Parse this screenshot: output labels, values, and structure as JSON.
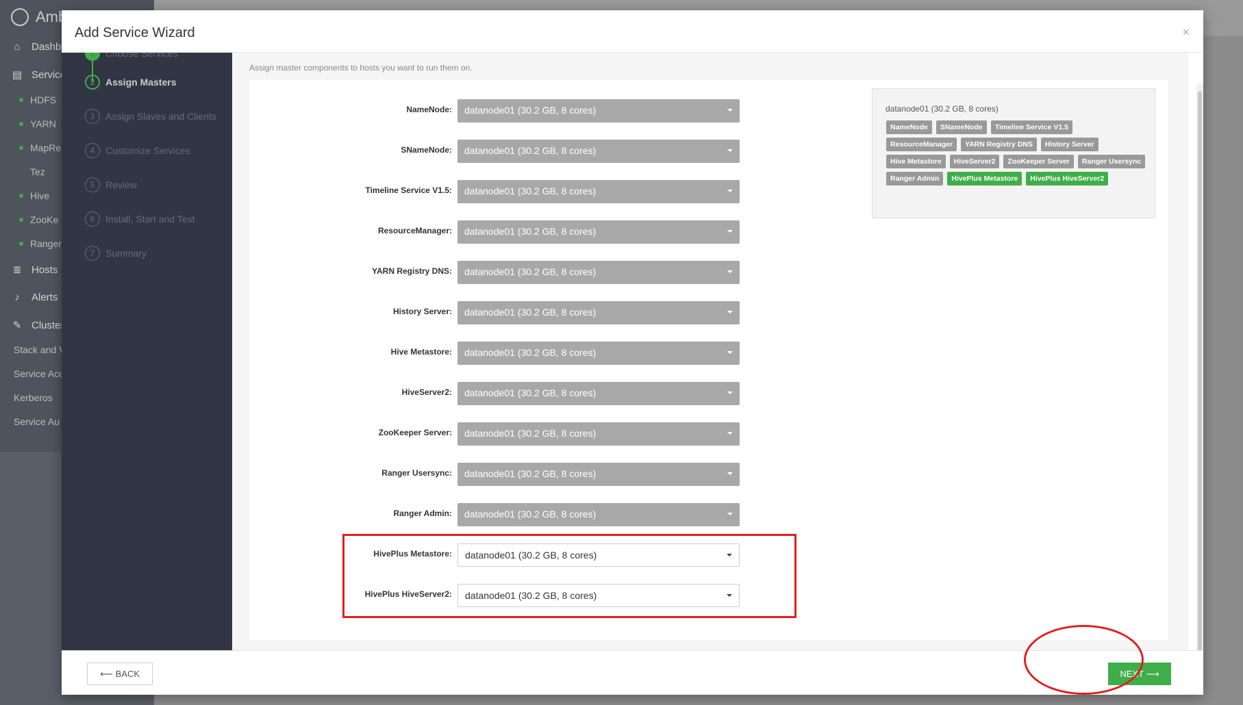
{
  "background": {
    "logo": "Amb",
    "nav": [
      {
        "label": "Dashbo",
        "icon": "home-icon"
      },
      {
        "label": "Service",
        "icon": "briefcase-icon"
      }
    ],
    "services": [
      {
        "label": "HDFS",
        "status": true
      },
      {
        "label": "YARN",
        "status": true
      },
      {
        "label": "MapRe",
        "status": true
      },
      {
        "label": "Tez",
        "status": false
      },
      {
        "label": "Hive",
        "status": true
      },
      {
        "label": "ZooKe",
        "status": true
      },
      {
        "label": "Ranger",
        "status": true
      }
    ],
    "nav2": [
      {
        "label": "Hosts",
        "icon": "server-icon"
      },
      {
        "label": "Alerts",
        "icon": "bell-icon"
      },
      {
        "label": "Cluster",
        "icon": "wrench-icon"
      }
    ],
    "cluster_items": [
      "Stack and V",
      "Service Acc",
      "Kerberos",
      "Service Au"
    ]
  },
  "modal": {
    "title": "Add Service Wizard",
    "close": "×"
  },
  "steps": [
    {
      "num": "1",
      "label": "Choose Services",
      "state": "done"
    },
    {
      "num": "2",
      "label": "Assign Masters",
      "state": "current"
    },
    {
      "num": "3",
      "label": "Assign Slaves and Clients",
      "state": "pending"
    },
    {
      "num": "4",
      "label": "Customize Services",
      "state": "pending"
    },
    {
      "num": "5",
      "label": "Review",
      "state": "pending"
    },
    {
      "num": "6",
      "label": "Install, Start and Test",
      "state": "pending"
    },
    {
      "num": "7",
      "label": "Summary",
      "state": "pending"
    }
  ],
  "intro": "Assign master components to hosts you want to run them on.",
  "assignments": [
    {
      "label": "NameNode:",
      "value": "datanode01 (30.2 GB, 8 cores)",
      "active": false
    },
    {
      "label": "SNameNode:",
      "value": "datanode01 (30.2 GB, 8 cores)",
      "active": false
    },
    {
      "label": "Timeline Service V1.5:",
      "value": "datanode01 (30.2 GB, 8 cores)",
      "active": false
    },
    {
      "label": "ResourceManager:",
      "value": "datanode01 (30.2 GB, 8 cores)",
      "active": false
    },
    {
      "label": "YARN Registry DNS:",
      "value": "datanode01 (30.2 GB, 8 cores)",
      "active": false
    },
    {
      "label": "History Server:",
      "value": "datanode01 (30.2 GB, 8 cores)",
      "active": false
    },
    {
      "label": "Hive Metastore:",
      "value": "datanode01 (30.2 GB, 8 cores)",
      "active": false
    },
    {
      "label": "HiveServer2:",
      "value": "datanode01 (30.2 GB, 8 cores)",
      "active": false
    },
    {
      "label": "ZooKeeper Server:",
      "value": "datanode01 (30.2 GB, 8 cores)",
      "active": false
    },
    {
      "label": "Ranger Usersync:",
      "value": "datanode01 (30.2 GB, 8 cores)",
      "active": false
    },
    {
      "label": "Ranger Admin:",
      "value": "datanode01 (30.2 GB, 8 cores)",
      "active": false
    },
    {
      "label": "HivePlus Metastore:",
      "value": "datanode01 (30.2 GB, 8 cores)",
      "active": true
    },
    {
      "label": "HivePlus HiveServer2:",
      "value": "datanode01 (30.2 GB, 8 cores)",
      "active": true
    }
  ],
  "host_summary": {
    "title": "datanode01 (30.2 GB, 8 cores)",
    "tags": [
      {
        "label": "NameNode",
        "new": false
      },
      {
        "label": "SNameNode",
        "new": false
      },
      {
        "label": "Timeline Service V1.5",
        "new": false
      },
      {
        "label": "ResourceManager",
        "new": false
      },
      {
        "label": "YARN Registry DNS",
        "new": false
      },
      {
        "label": "History Server",
        "new": false
      },
      {
        "label": "Hive Metastore",
        "new": false
      },
      {
        "label": "HiveServer2",
        "new": false
      },
      {
        "label": "ZooKeeper Server",
        "new": false
      },
      {
        "label": "Ranger Usersync",
        "new": false
      },
      {
        "label": "Ranger Admin",
        "new": false
      },
      {
        "label": "HivePlus Metastore",
        "new": true
      },
      {
        "label": "HivePlus HiveServer2",
        "new": true
      }
    ]
  },
  "footer": {
    "back_label": "BACK",
    "back_arrow": "⟵",
    "next_label": "NEXT",
    "next_arrow": "⟶"
  },
  "colors": {
    "accent_green": "#3fae49",
    "annotation_red": "#e0201f",
    "wizard_nav_bg": "#323544"
  }
}
